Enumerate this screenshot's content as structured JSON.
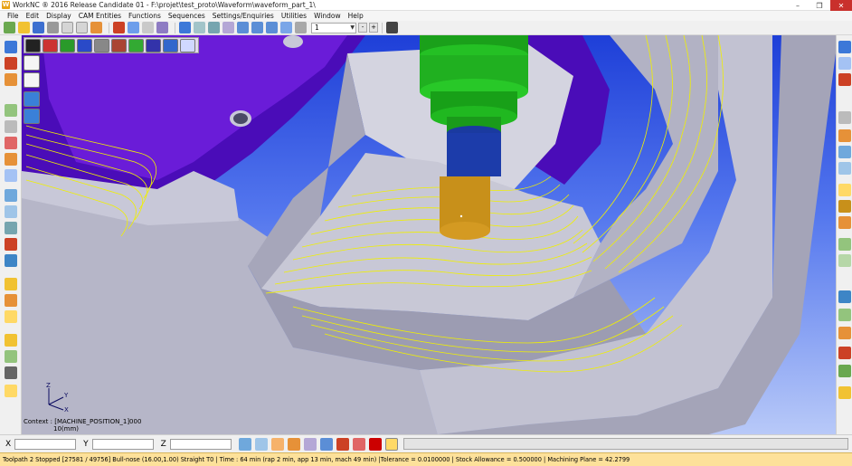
{
  "window": {
    "app_logo": "W",
    "title": "WorkNC ® 2016 Release Candidate 01 - F:\\projet\\test_proto\\Waveform\\waveform_part_1\\",
    "controls": [
      "–",
      "❐",
      "✕"
    ]
  },
  "menu": {
    "items": [
      "File",
      "Edit",
      "Display",
      "CAM Entities",
      "Functions",
      "Sequences",
      "Settings/Enquiries",
      "Utilities",
      "Window",
      "Help"
    ]
  },
  "toolbar": {
    "select_value": "1",
    "minus_label": "-",
    "plus_label": "+"
  },
  "viewport": {
    "axis_labels": {
      "z": "Z",
      "y": "Y",
      "x": "X"
    },
    "context_text": "Context : [MACHINE_POSITION_1]000",
    "scale_text": "10(mm)"
  },
  "coords": {
    "x_label": "X",
    "y_label": "Y",
    "z_label": "Z",
    "x_value": "",
    "y_value": "",
    "z_value": ""
  },
  "status": {
    "text": "Toolpath 2   Stopped [27581 / 49756]   Bull-nose (16.00,1.00) Straight T0 | Time : 64 min (rap 2 min, app 13 min, mach 49 min) |Tolerance = 0.0100000 | Stock Allowance = 0.500000 | Machining Plane = 42.2799"
  },
  "colors": {
    "bg_top": "#1e3fd8",
    "bg_bottom": "#b8c9f8",
    "part_gray": "#c4c4d4",
    "part_purple": "#5a10c8",
    "toolpath": "#f0f000",
    "holder_green": "#20c020",
    "spindle_blue": "#1a3aa0",
    "cutter_gold": "#c8901a",
    "status_bg": "#fde19a"
  }
}
